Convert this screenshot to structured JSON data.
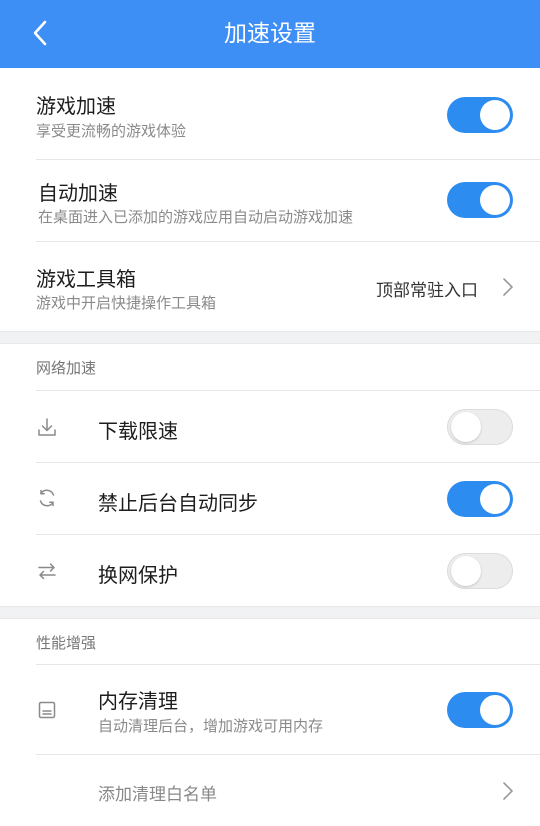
{
  "header": {
    "title": "加速设置",
    "back_icon": "back-chevron-icon"
  },
  "colors": {
    "accent": "#3d8ff5",
    "toggle_on": "#2d8cf0",
    "toggle_off": "#ededed"
  },
  "game_section": {
    "items": [
      {
        "title": "游戏加速",
        "subtitle": "享受更流畅的游戏体验",
        "enabled": true
      },
      {
        "title": "自动加速",
        "subtitle": "在桌面进入已添加的游戏应用自动启动游戏加速",
        "enabled": true
      },
      {
        "title": "游戏工具箱",
        "subtitle": "游戏中开启快捷操作工具箱",
        "value": "顶部常驻入口"
      }
    ]
  },
  "network_section": {
    "title": "网络加速",
    "items": [
      {
        "title": "下载限速",
        "icon": "download-icon",
        "enabled": false
      },
      {
        "title": "禁止后台自动同步",
        "icon": "sync-icon",
        "enabled": true
      },
      {
        "title": "换网保护",
        "icon": "swap-arrows-icon",
        "enabled": false
      }
    ]
  },
  "performance_section": {
    "title": "性能增强",
    "items": [
      {
        "title": "内存清理",
        "subtitle": "自动清理后台，增加游戏可用内存",
        "icon": "memory-icon",
        "enabled": true
      },
      {
        "title": "添加清理白名单"
      }
    ]
  }
}
